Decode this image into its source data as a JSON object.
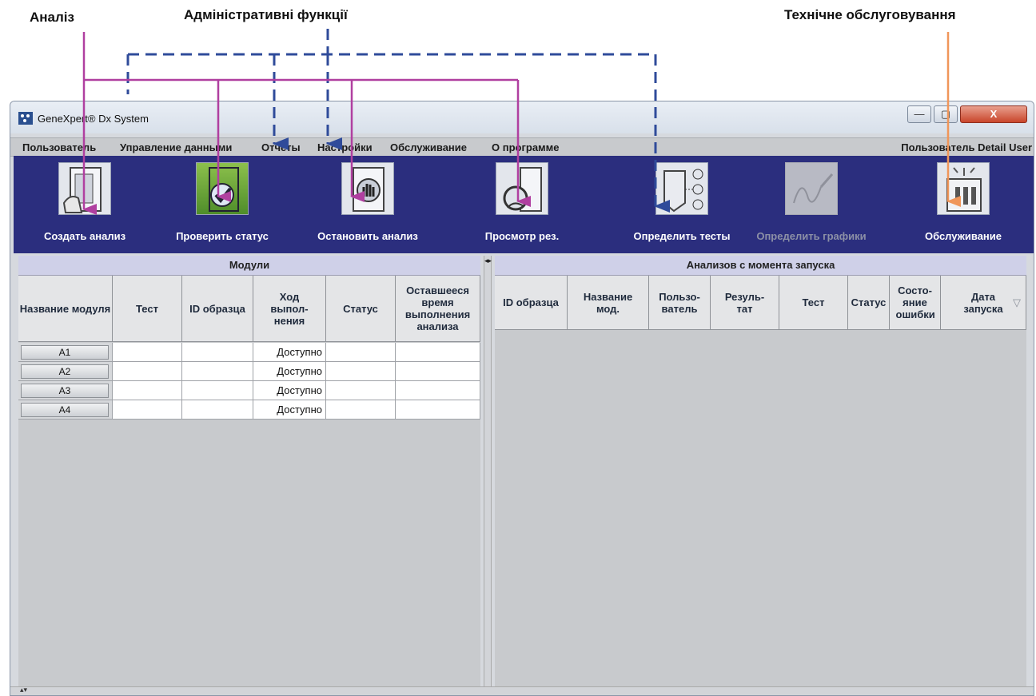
{
  "callouts": {
    "analysis": "Аналіз",
    "admin": "Адміністративні функції",
    "maintenance": "Технічне обслуговування"
  },
  "colors": {
    "analysis_line": "#b03fa0",
    "admin_line": "#2f4b9a",
    "maintenance_line": "#f0965a",
    "toolbar_bg": "#2b2e7e"
  },
  "window": {
    "title": "GeneXpert® Dx System",
    "minimize": "—",
    "maximize": "▢",
    "close": "X"
  },
  "menu": {
    "items": [
      "Пользователь",
      "Управление данными",
      "Отчеты",
      "Настройки",
      "Обслуживание",
      "О программе"
    ],
    "user_label": "Пользователь Detail User"
  },
  "toolbar": {
    "buttons": [
      {
        "label": "Создать анализ",
        "icon": "create-test-icon"
      },
      {
        "label": "Проверить статус",
        "icon": "check-status-icon"
      },
      {
        "label": "Остановить анализ",
        "icon": "stop-test-icon"
      },
      {
        "label": "Просмотр рез.",
        "icon": "view-results-icon"
      },
      {
        "label": "Определить тесты",
        "icon": "define-assays-icon"
      },
      {
        "label": "Определить графики",
        "icon": "define-graphs-icon",
        "disabled": true
      },
      {
        "label": "Обслуживание",
        "icon": "maintenance-icon"
      }
    ]
  },
  "modules_pane": {
    "title": "Модули",
    "columns": [
      "Название модуля",
      "Тест",
      "ID образца",
      "Ход выпол- нения",
      "Статус",
      "Оставшееся время выполнения анализа"
    ],
    "rows": [
      {
        "module": "A1",
        "test": "",
        "sample_id": "",
        "progress": "Доступно",
        "status": "",
        "remaining": ""
      },
      {
        "module": "A2",
        "test": "",
        "sample_id": "",
        "progress": "Доступно",
        "status": "",
        "remaining": ""
      },
      {
        "module": "A3",
        "test": "",
        "sample_id": "",
        "progress": "Доступно",
        "status": "",
        "remaining": ""
      },
      {
        "module": "A4",
        "test": "",
        "sample_id": "",
        "progress": "Доступно",
        "status": "",
        "remaining": ""
      }
    ]
  },
  "tests_pane": {
    "title": "Анализов с момента запуска",
    "columns": [
      "ID образца",
      "Название мод.",
      "Пользо- ватель",
      "Резуль- тат",
      "Тест",
      "Статус",
      "Состо- яние ошибки",
      "Дата запуска"
    ],
    "sort_indicator": "▽"
  },
  "splitter_arrows": "◂▸",
  "scroll_arrows": "▴▾"
}
